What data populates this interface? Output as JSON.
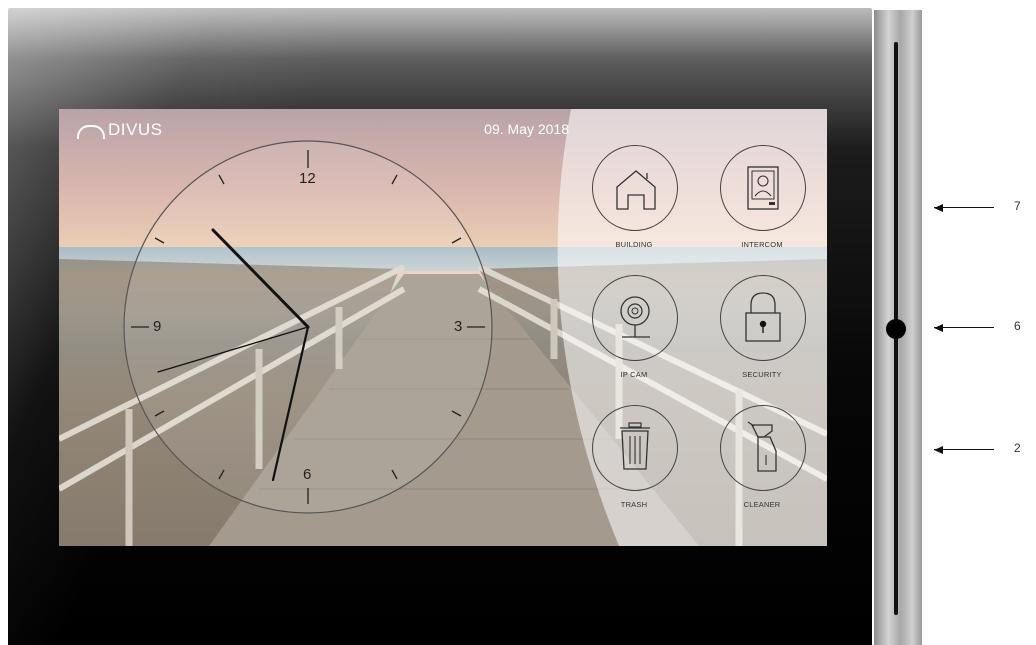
{
  "brand": {
    "name": "DIVUS"
  },
  "date": "09. May 2018",
  "clock": {
    "numerals": {
      "twelve": "12",
      "three": "3",
      "six": "6",
      "nine": "9"
    }
  },
  "tiles": [
    {
      "label": "BUILDING",
      "icon": "house-icon"
    },
    {
      "label": "INTERCOM",
      "icon": "intercom-icon"
    },
    {
      "label": "IP CAM",
      "icon": "ip-camera-icon"
    },
    {
      "label": "SECURITY",
      "icon": "padlock-icon"
    },
    {
      "label": "TRASH",
      "icon": "trash-bin-icon"
    },
    {
      "label": "CLEANER",
      "icon": "spray-bottle-icon"
    }
  ],
  "callouts": [
    "7",
    "6",
    "2"
  ]
}
